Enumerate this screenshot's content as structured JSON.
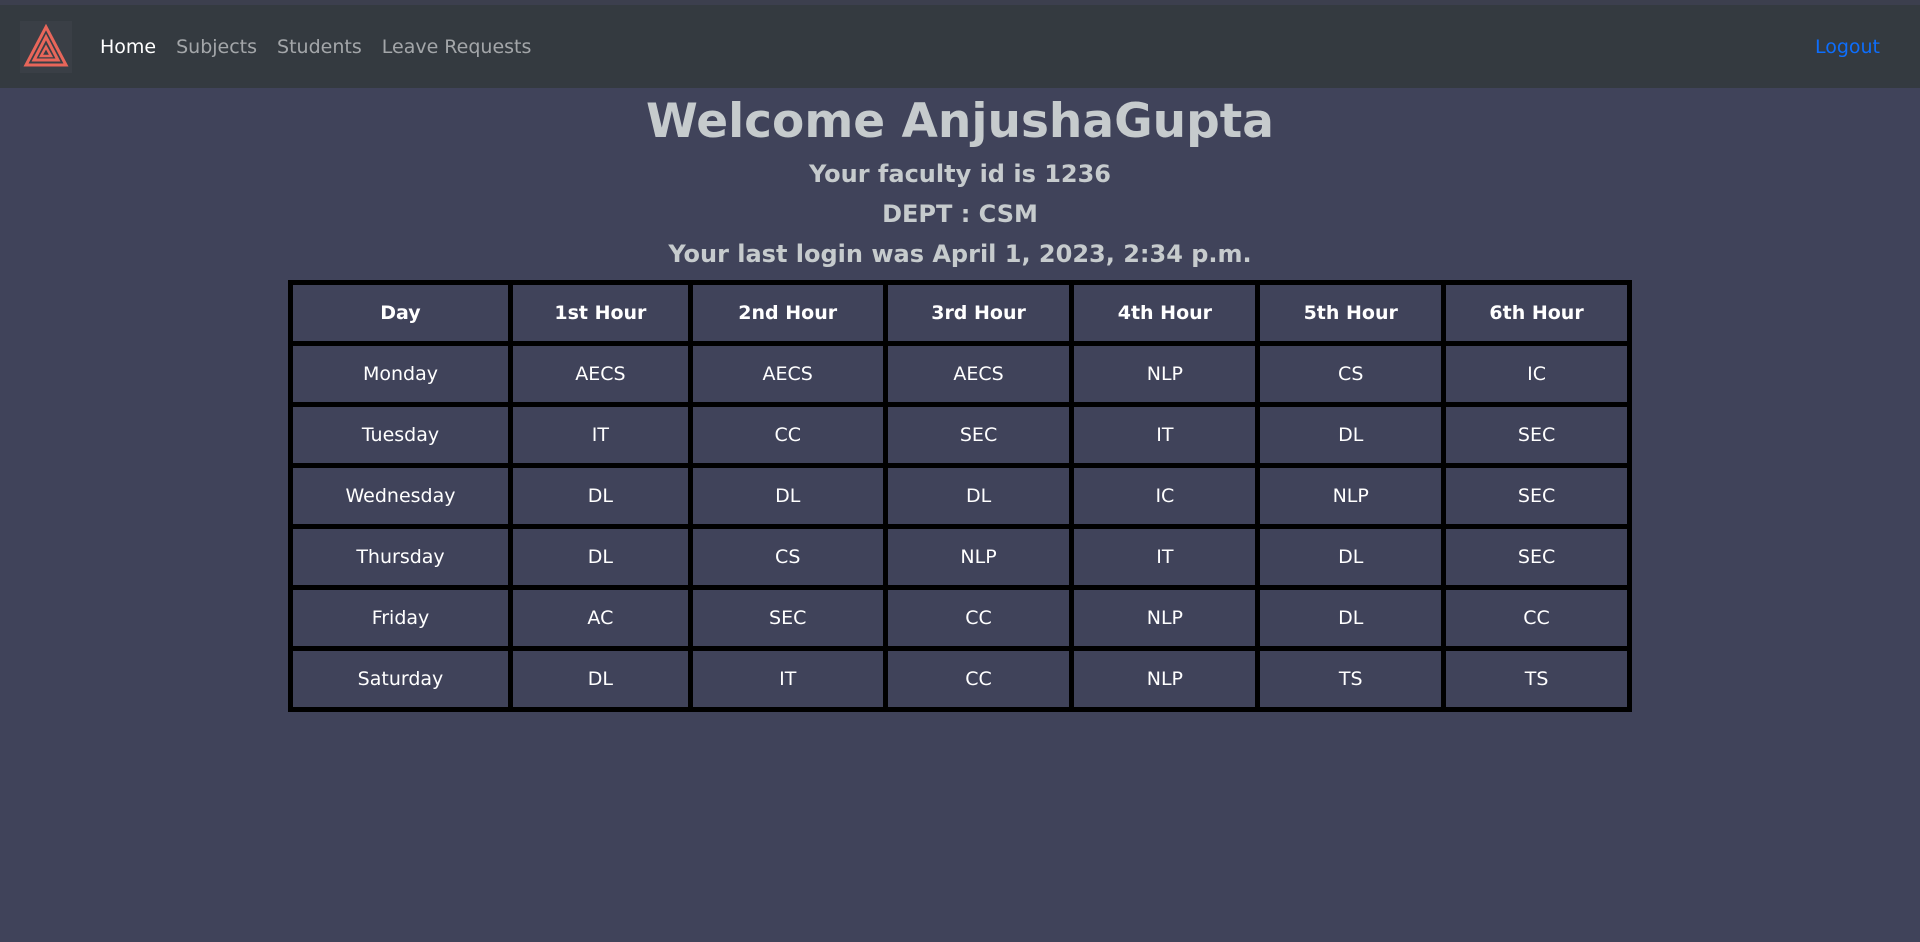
{
  "nav": {
    "links": [
      "Home",
      "Subjects",
      "Students",
      "Leave Requests"
    ],
    "active_index": 0,
    "logout_label": "Logout",
    "logo_color": "#e8665a"
  },
  "hero": {
    "welcome": "Welcome AnjushaGupta",
    "faculty_line": "Your faculty id is 1236",
    "dept_line": "DEPT : CSM",
    "last_login_line": "Your last login was April 1, 2023, 2:34 p.m."
  },
  "timetable": {
    "headers": [
      "Day",
      "1st Hour",
      "2nd Hour",
      "3rd Hour",
      "4th Hour",
      "5th Hour",
      "6th Hour"
    ],
    "rows": [
      [
        "Monday",
        "AECS",
        "AECS",
        "AECS",
        "NLP",
        "CS",
        "IC"
      ],
      [
        "Tuesday",
        "IT",
        "CC",
        "SEC",
        "IT",
        "DL",
        "SEC"
      ],
      [
        "Wednesday",
        "DL",
        "DL",
        "DL",
        "IC",
        "NLP",
        "SEC"
      ],
      [
        "Thursday",
        "DL",
        "CS",
        "NLP",
        "IT",
        "DL",
        "SEC"
      ],
      [
        "Friday",
        "AC",
        "SEC",
        "CC",
        "NLP",
        "DL",
        "CC"
      ],
      [
        "Saturday",
        "DL",
        "IT",
        "CC",
        "NLP",
        "TS",
        "TS"
      ]
    ]
  }
}
